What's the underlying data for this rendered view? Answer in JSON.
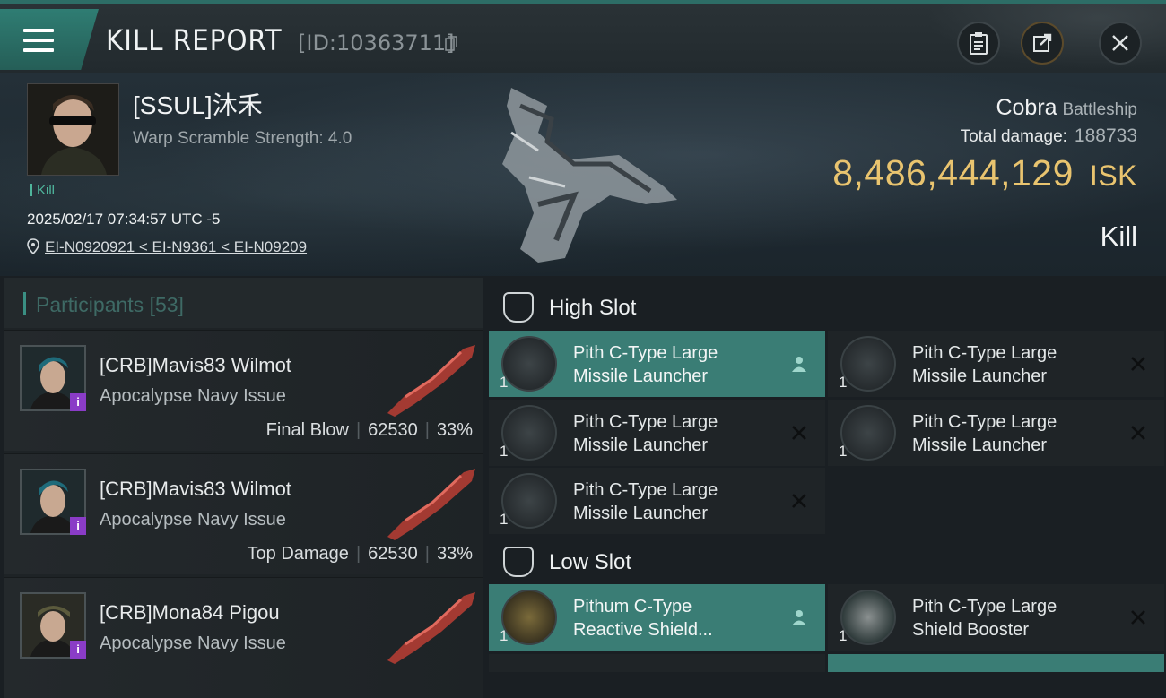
{
  "header": {
    "title": "KILL REPORT",
    "report_id": "[ID:10363711]"
  },
  "victim": {
    "name": "[SSUL]沐禾",
    "warp_scramble": "Warp Scramble Strength: 4.0",
    "kill_tag": "Kill",
    "datetime": "2025/02/17 07:34:57 UTC -5",
    "location": "EI-N0920921 < EI-N9361 < EI-N09209"
  },
  "summary": {
    "ship_name": "Cobra",
    "ship_class": "Battleship",
    "total_damage_label": "Total damage:",
    "total_damage": "188733",
    "isk_value": "8,486,444,129",
    "isk_unit": "ISK",
    "result": "Kill"
  },
  "participants": {
    "label": "Participants",
    "count": "[53]",
    "rows": [
      {
        "name": "[CRB]Mavis83 Wilmot",
        "ship": "Apocalypse Navy Issue",
        "role": "Final Blow",
        "damage": "62530",
        "percent": "33%"
      },
      {
        "name": "[CRB]Mavis83 Wilmot",
        "ship": "Apocalypse Navy Issue",
        "role": "Top Damage",
        "damage": "62530",
        "percent": "33%"
      },
      {
        "name": "[CRB]Mona84 Pigou",
        "ship": "Apocalypse Navy Issue",
        "role": "",
        "damage": "",
        "percent": ""
      }
    ],
    "badge": "i"
  },
  "fitting": {
    "high_slot_label": "High Slot",
    "low_slot_label": "Low Slot",
    "high_modules": [
      {
        "line1": "Pith C-Type Large",
        "line2": "Missile Launcher",
        "qty": "1",
        "state": "dropped"
      },
      {
        "line1": "Pith C-Type Large",
        "line2": "Missile Launcher",
        "qty": "1",
        "state": "destroyed"
      },
      {
        "line1": "Pith C-Type Large",
        "line2": "Missile Launcher",
        "qty": "1",
        "state": "destroyed"
      },
      {
        "line1": "Pith C-Type Large",
        "line2": "Missile Launcher",
        "qty": "1",
        "state": "destroyed"
      },
      {
        "line1": "Pith C-Type Large",
        "line2": "Missile Launcher",
        "qty": "1",
        "state": "destroyed"
      }
    ],
    "low_modules": [
      {
        "line1": "Pithum C-Type",
        "line2": "Reactive Shield...",
        "qty": "1",
        "state": "dropped"
      },
      {
        "line1": "Pith C-Type Large",
        "line2": "Shield Booster",
        "qty": "1",
        "state": "destroyed"
      }
    ]
  },
  "colors": {
    "accent_teal": "#3a7d75",
    "isk_gold": "#e9c46f",
    "badge_purple": "#8a3cc7"
  }
}
